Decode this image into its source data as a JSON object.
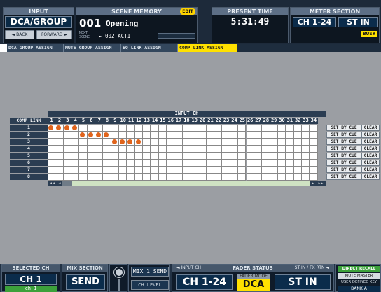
{
  "header": {
    "input_label": "INPUT",
    "mode_title": "DCA/GROUP",
    "back_label": "◄ BACK",
    "forward_label": "FORWARD ►",
    "scene_memory_label": "SCENE MEMORY",
    "edit_badge": "EDIT",
    "scene_number": "001",
    "scene_name": "Opening",
    "next_label": "NEXT\nSCENE",
    "next_scene": "► 002 ACT1",
    "present_time_label": "PRESENT TIME",
    "present_time": "5:31:49",
    "meter_section_label": "METER SECTION",
    "meter_ch": "CH 1-24",
    "meter_st": "ST IN",
    "busy_badge": "BUSY"
  },
  "tabs": [
    {
      "label": "DCA GROUP ASSIGN",
      "active": false
    },
    {
      "label": "MUTE GROUP ASSIGN",
      "active": false
    },
    {
      "label": "EQ LINK ASSIGN",
      "active": false
    },
    {
      "label": "COMP LINK ASSIGN",
      "active": true
    }
  ],
  "grid": {
    "header_label": "INPUT CH",
    "corner_label": "COMP LINK",
    "columns": [
      "1",
      "2",
      "3",
      "4",
      "5",
      "6",
      "7",
      "8",
      "9",
      "10",
      "11",
      "12",
      "13",
      "14",
      "15",
      "16",
      "17",
      "18",
      "19",
      "20",
      "21",
      "22",
      "23",
      "24",
      "25",
      "26",
      "27",
      "28",
      "29",
      "30",
      "31",
      "32",
      "33",
      "34"
    ],
    "rows": [
      "1",
      "2",
      "3",
      "4",
      "5",
      "6",
      "7",
      "8"
    ],
    "assignments": [
      [
        1,
        2,
        3,
        4
      ],
      [
        5,
        6,
        7,
        8
      ],
      [
        9,
        10,
        11,
        12
      ],
      [],
      [],
      [],
      [],
      []
    ],
    "set_by_cue_label": "SET BY CUE",
    "clear_label": "CLEAR",
    "scroll_left": "◄◄",
    "scroll_left_one": "◄",
    "scroll_right_one": "►",
    "scroll_right": "►►"
  },
  "footer": {
    "selected_ch_label": "SELECTED CH",
    "selected_ch": "CH 1",
    "selected_ch_name": "ch 1",
    "mix_section_label": "MIX SECTION",
    "mix_send": "SEND",
    "mix1_send": "MIX 1 SEND",
    "ch_level": "CH LEVEL",
    "fader_status_label": "FADER STATUS",
    "input_ch_label": "◄ INPUT CH",
    "input_ch": "CH 1-24",
    "fader_mode_label": "FADER MODE",
    "fader_mode": "DCA",
    "st_in_fx_label": "ST IN / FX RTN ◄",
    "st_in": "ST IN",
    "direct_recall": "DIRECT RECALL",
    "mute_master": "MUTE MASTER",
    "user_defined_key": "USER DEFINED KEY",
    "bank": "BANK A"
  },
  "colors": {
    "assigned_dot": "#e0641c",
    "active_tab": "#ffe100",
    "edit_badge": "#ffd400",
    "busy_badge": "#ffe100"
  }
}
